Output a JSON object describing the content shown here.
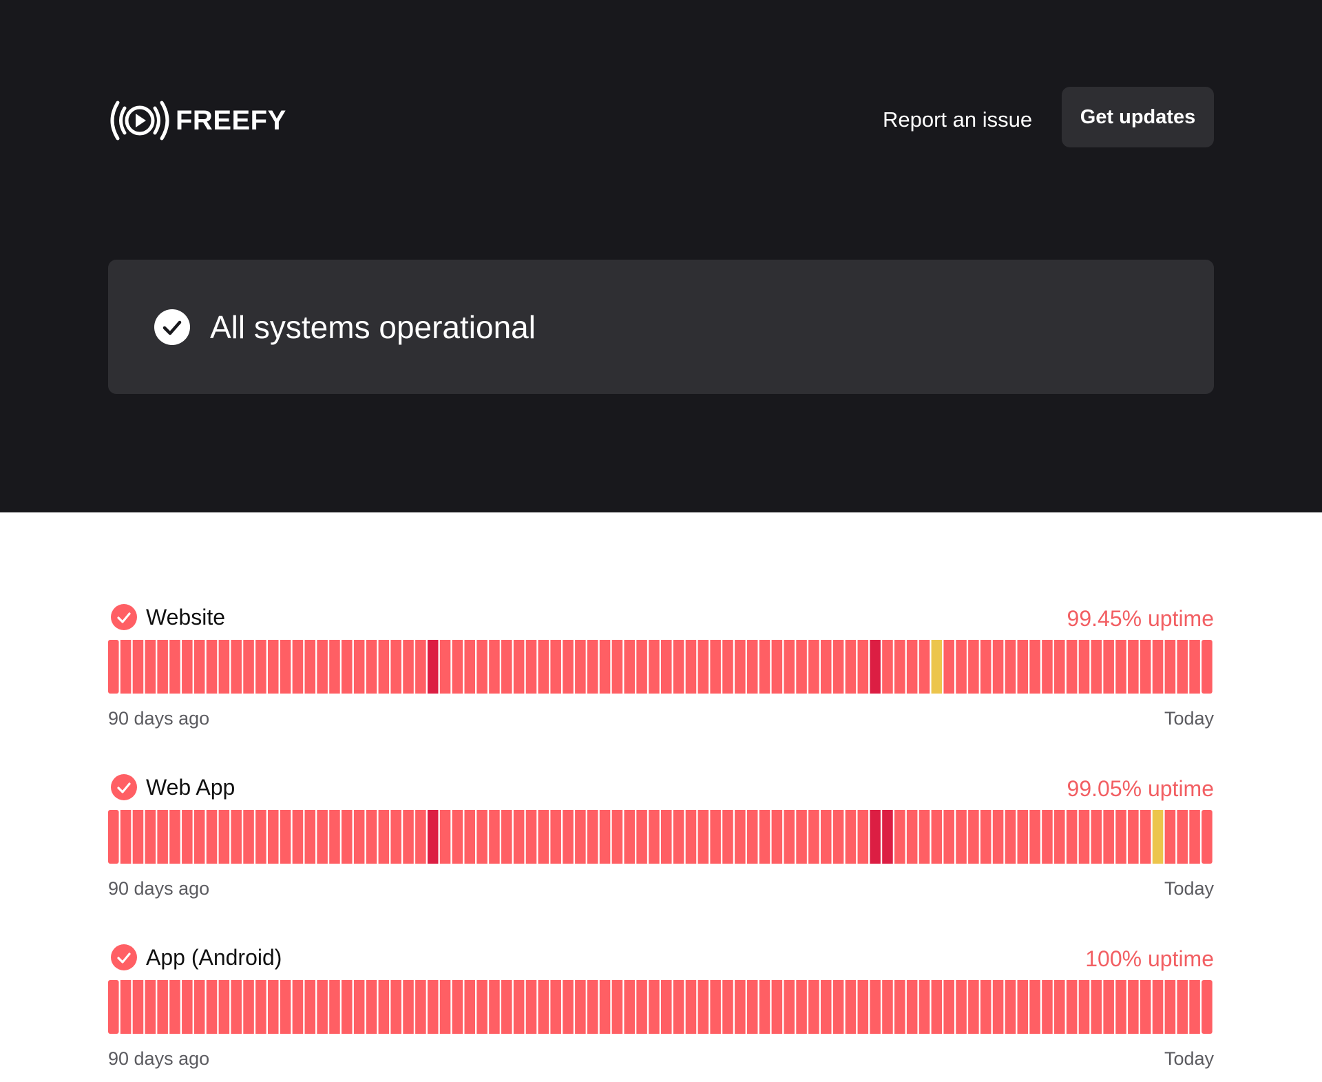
{
  "header": {
    "brand": "FREEFY",
    "logo_icon": "broadcast-play-icon",
    "report_label": "Report an issue",
    "updates_label": "Get updates"
  },
  "status": {
    "icon": "check-circle-icon",
    "text": "All systems operational"
  },
  "colors": {
    "hero_bg": "#18181c",
    "card_bg": "#2f2f33",
    "operational": "#ff5f64",
    "outage": "#dc1e43",
    "degraded": "#ecc54c",
    "uptime_text": "#f25f63"
  },
  "services": [
    {
      "name": "Website",
      "uptime": "99.45% uptime",
      "range_start": "90 days ago",
      "range_end": "Today",
      "days": 90,
      "outage_days": [
        26,
        62
      ],
      "degraded_days": [
        67
      ]
    },
    {
      "name": "Web App",
      "uptime": "99.05% uptime",
      "range_start": "90 days ago",
      "range_end": "Today",
      "days": 90,
      "outage_days": [
        26,
        62,
        63
      ],
      "degraded_days": [
        85
      ]
    },
    {
      "name": "App (Android)",
      "uptime": "100% uptime",
      "range_start": "90 days ago",
      "range_end": "Today",
      "days": 90,
      "outage_days": [],
      "degraded_days": []
    }
  ]
}
